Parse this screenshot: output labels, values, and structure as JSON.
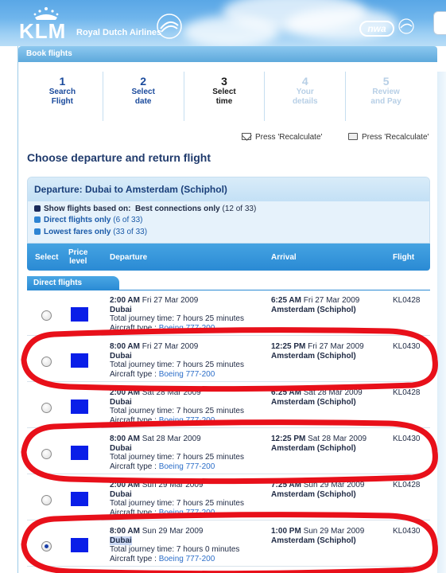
{
  "header": {
    "brand": "KLM",
    "brand_subtitle": "Royal Dutch Airlines",
    "partner_logo": "nwa"
  },
  "panel": {
    "title": "Book flights"
  },
  "steps": [
    {
      "num": "1",
      "line1": "Search",
      "line2": "Flight",
      "state": "done"
    },
    {
      "num": "2",
      "line1": "Select",
      "line2": "date",
      "state": "done"
    },
    {
      "num": "3",
      "line1": "Select",
      "line2": "time",
      "state": "active"
    },
    {
      "num": "4",
      "line1": "Your",
      "line2": "details",
      "state": "disabled"
    },
    {
      "num": "5",
      "line1": "Review",
      "line2": "and Pay",
      "state": "disabled"
    }
  ],
  "actions": {
    "email_label": "Press 'Recalculate'",
    "print_label": "Press 'Recalculate'"
  },
  "page_title": "Choose departure and return flight",
  "departure": {
    "title": "Departure: Dubai to Amsterdam (Schiphol)",
    "filter_prefix": "Show flights based on:",
    "filter_current": "Best connections only",
    "filter_current_count": "(12 of 33)",
    "filter_direct": "Direct flights only",
    "filter_direct_count": "(6 of 33)",
    "filter_lowest": "Lowest fares only",
    "filter_lowest_count": "(33 of 33)"
  },
  "table": {
    "headers": {
      "select": "Select",
      "price_1": "Price",
      "price_2": "level",
      "departure": "Departure",
      "arrival": "Arrival",
      "flight": "Flight"
    },
    "group_label": "Direct flights",
    "rows": [
      {
        "dep_time": "2:00 AM",
        "dep_date": "Fri 27 Mar 2009",
        "dep_city": "Dubai",
        "journey": "Total journey time: 7 hours 25 minutes",
        "aircraft_prefix": "Aircraft type :",
        "aircraft": "Boeing 777-200",
        "arr_time": "6:25 AM",
        "arr_date": "Fri 27 Mar 2009",
        "arr_city": "Amsterdam (Schiphol)",
        "flight": "KL0428",
        "selected": false,
        "circled": false
      },
      {
        "dep_time": "8:00 AM",
        "dep_date": "Fri 27 Mar 2009",
        "dep_city": "Dubai",
        "journey": "Total journey time: 7 hours 25 minutes",
        "aircraft_prefix": "Aircraft type :",
        "aircraft": "Boeing 777-200",
        "arr_time": "12:25 PM",
        "arr_date": "Fri 27 Mar 2009",
        "arr_city": "Amsterdam (Schiphol)",
        "flight": "KL0430",
        "selected": false,
        "circled": true
      },
      {
        "dep_time": "2:00 AM",
        "dep_date": "Sat 28 Mar 2009",
        "dep_city": "Dubai",
        "journey": "Total journey time: 7 hours 25 minutes",
        "aircraft_prefix": "Aircraft type :",
        "aircraft": "Boeing 777-200",
        "arr_time": "6:25 AM",
        "arr_date": "Sat 28 Mar 2009",
        "arr_city": "Amsterdam (Schiphol)",
        "flight": "KL0428",
        "selected": false,
        "circled": false
      },
      {
        "dep_time": "8:00 AM",
        "dep_date": "Sat 28 Mar 2009",
        "dep_city": "Dubai",
        "journey": "Total journey time: 7 hours 25 minutes",
        "aircraft_prefix": "Aircraft type :",
        "aircraft": "Boeing 777-200",
        "arr_time": "12:25 PM",
        "arr_date": "Sat 28 Mar 2009",
        "arr_city": "Amsterdam (Schiphol)",
        "flight": "KL0430",
        "selected": false,
        "circled": true
      },
      {
        "dep_time": "2:00 AM",
        "dep_date": "Sun 29 Mar 2009",
        "dep_city": "Dubai",
        "journey": "Total journey time: 7 hours 25 minutes",
        "aircraft_prefix": "Aircraft type :",
        "aircraft": "Boeing 777-200",
        "arr_time": "7:25 AM",
        "arr_date": "Sun 29 Mar 2009",
        "arr_city": "Amsterdam (Schiphol)",
        "flight": "KL0428",
        "selected": false,
        "circled": false
      },
      {
        "dep_time": "8:00 AM",
        "dep_date": "Sun 29 Mar 2009",
        "dep_city": "Dubai",
        "journey": "Total journey time: 7 hours 0 minutes",
        "aircraft_prefix": "Aircraft type :",
        "aircraft": "Boeing 777-200",
        "arr_time": "1:00 PM",
        "arr_date": "Sun 29 Mar 2009",
        "arr_city": "Amsterdam (Schiphol)",
        "flight": "KL0430",
        "selected": true,
        "circled": true
      }
    ]
  },
  "colors": {
    "brand_blue": "#2a8ad4",
    "price_level": "#0a1ee8",
    "annotation_red": "#e8101a"
  }
}
